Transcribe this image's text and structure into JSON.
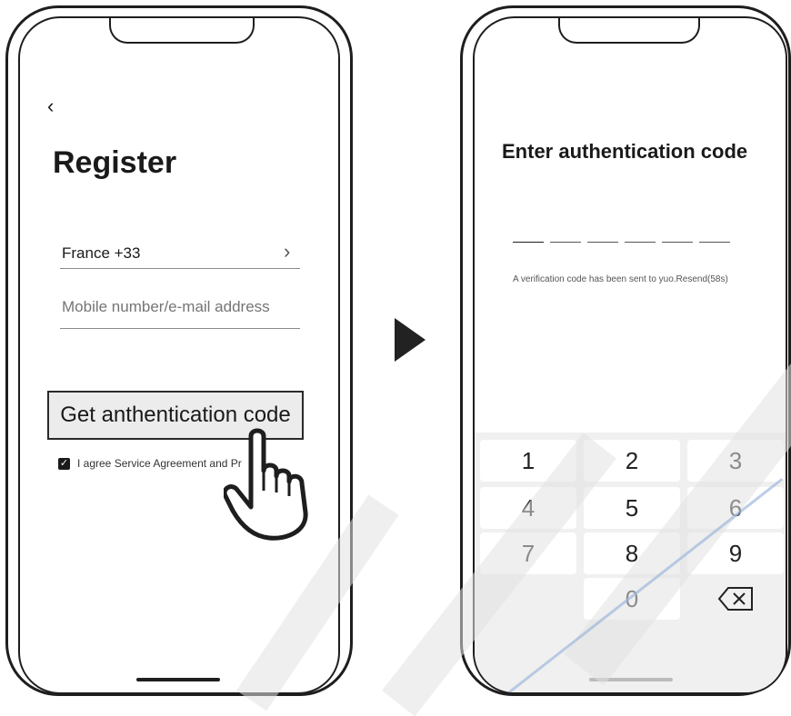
{
  "left_screen": {
    "back_glyph": "‹",
    "title": "Register",
    "country_field": {
      "value": "France +33",
      "chevron": "›"
    },
    "contact_field": {
      "placeholder": "Mobile number/e-mail address"
    },
    "get_code_button": "Get anthentication code",
    "agreement": {
      "checked": true,
      "label": "I agree Service Agreement and Pr"
    }
  },
  "arrow_icon": "play-arrow-icon",
  "right_screen": {
    "title": "Enter authentication code",
    "code_slot_count": 6,
    "note": "A verification code has been sent to yuo.Resend(58s)",
    "keypad": {
      "keys": [
        "1",
        "2",
        "3",
        "4",
        "5",
        "6",
        "7",
        "8",
        "9",
        "",
        "0",
        "⌫"
      ]
    }
  },
  "colors": {
    "ink": "#1e1e1e",
    "button_bg": "#ececec",
    "keypad_bg": "#f0f0f0",
    "watermark_accent": "#9fb8dc"
  }
}
